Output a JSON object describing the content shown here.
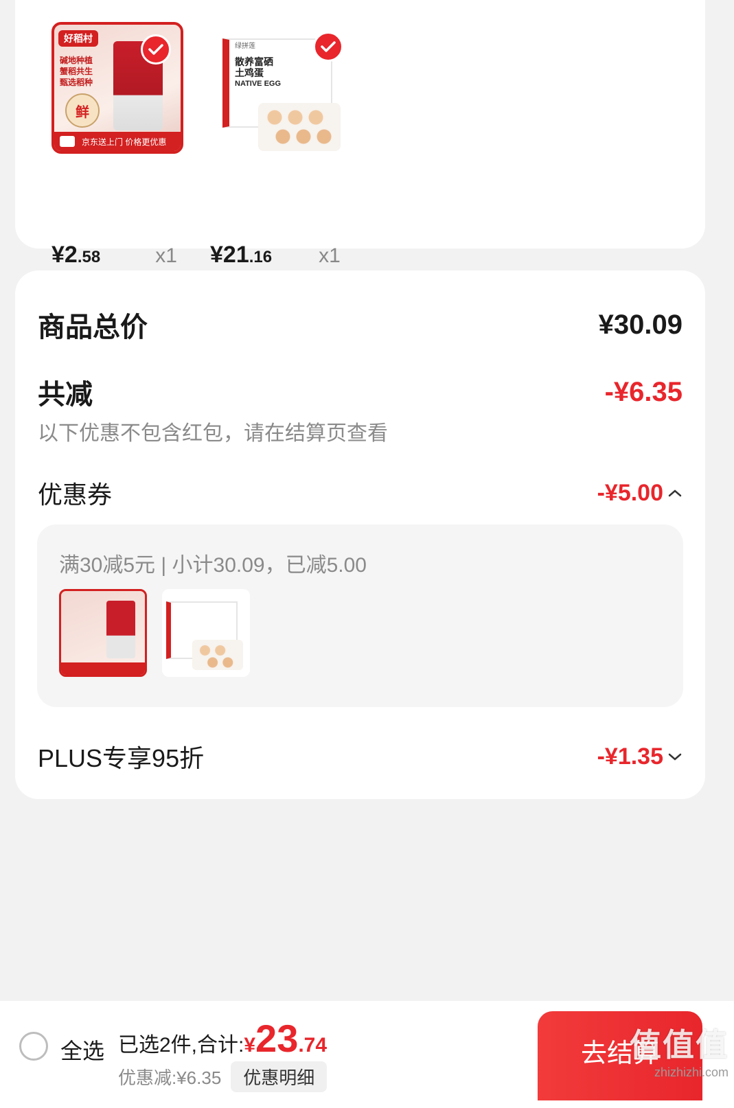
{
  "products": [
    {
      "price_int": "¥2",
      "price_dec": ".58",
      "qty": "x1",
      "name": "rice-product",
      "brand": "好稻村",
      "lines": [
        "碱地种植",
        "蟹稻共生",
        "甄选稻种"
      ],
      "badge": "鲜",
      "banner": "京东送上门 价格更优惠"
    },
    {
      "price_int": "¥21",
      "price_dec": ".16",
      "qty": "x1",
      "name": "egg-product",
      "brand": "绿拼莲",
      "lines": [
        "散养富硒",
        "土鸡蛋"
      ],
      "sub": "NATIVE EGG"
    }
  ],
  "summary": {
    "total_label": "商品总价",
    "total_value": "¥30.09",
    "reduce_label": "共减",
    "reduce_value": "-¥6.35",
    "note": "以下优惠不包含红包，请在结算页查看",
    "coupon_label": "优惠券",
    "coupon_value": "-¥5.00",
    "coupon_detail": "满30减5元 | 小计30.09，已减5.00",
    "plus_label": "PLUS专享95折",
    "plus_value": "-¥1.35"
  },
  "bottom": {
    "select_all": "全选",
    "selected_label": "已选2件,合计:",
    "currency": "¥",
    "total_int": "23",
    "total_dec": ".74",
    "discount_label": "优惠减:¥6.35",
    "detail_button": "优惠明细",
    "checkout": "去结算"
  },
  "watermark": {
    "big": "值值值",
    "small": "zhizhizhi.com"
  },
  "colors": {
    "accent": "#e8262c"
  }
}
